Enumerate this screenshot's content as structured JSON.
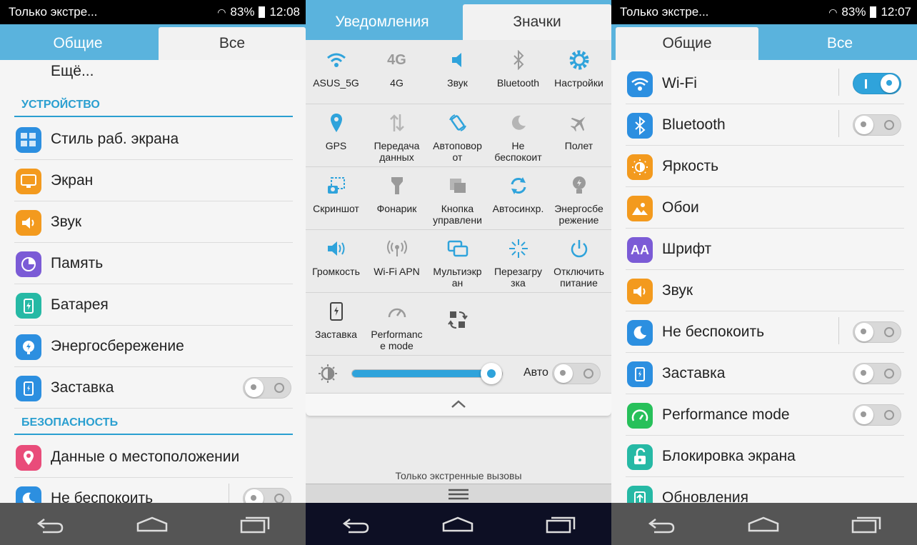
{
  "panel1": {
    "status": {
      "carrier": "Только экстре...",
      "battery": "83%",
      "time": "12:08"
    },
    "tabs": [
      "Общие",
      "Все"
    ],
    "more_item": "Ещё...",
    "section_device": "УСТРОЙСТВО",
    "items": [
      "Стиль раб. экрана",
      "Экран",
      "Звук",
      "Память",
      "Батарея",
      "Энергосбережение",
      "Заставка"
    ],
    "section_security": "БЕЗОПАСНОСТЬ",
    "security_items": [
      "Данные о местоположении",
      "Не беспокоить"
    ]
  },
  "panel2": {
    "tabs": [
      "Уведомления",
      "Значки"
    ],
    "tiles": [
      "ASUS_5G",
      "4G",
      "Звук",
      "Bluetooth",
      "Настройки",
      "GPS",
      "Передача данных",
      "Автоповор от",
      "Не беспокоит",
      "Полет",
      "Скриншот",
      "Фонарик",
      "Кнопка управлени",
      "Автосинхр.",
      "Энергосбе режение",
      "Громкость",
      "Wi-Fi APN",
      "Мультиэкр ан",
      "Перезагру зка",
      "Отключить питание",
      "Заставка",
      "Performanc e mode"
    ],
    "brightness_auto": "Авто",
    "brightness_level": 0.93,
    "emergency_text": "Только экстренные вызовы"
  },
  "panel3": {
    "status": {
      "carrier": "Только экстре...",
      "battery": "83%",
      "time": "12:07"
    },
    "tabs": [
      "Общие",
      "Все"
    ],
    "items": [
      "Wi-Fi",
      "Bluetooth",
      "Яркость",
      "Обои",
      "Шрифт",
      "Звук",
      "Не беспокоить",
      "Заставка",
      "Performance mode",
      "Блокировка экрана",
      "Обновления"
    ]
  },
  "colors": {
    "accent": "#2fa3db",
    "tabbar": "#5ab3dd",
    "orange": "#f39a1e",
    "purple": "#7b5bd6",
    "teal": "#26b9a5",
    "pink": "#e94c7a",
    "blue": "#2c8fe0",
    "green": "#27c05a"
  }
}
